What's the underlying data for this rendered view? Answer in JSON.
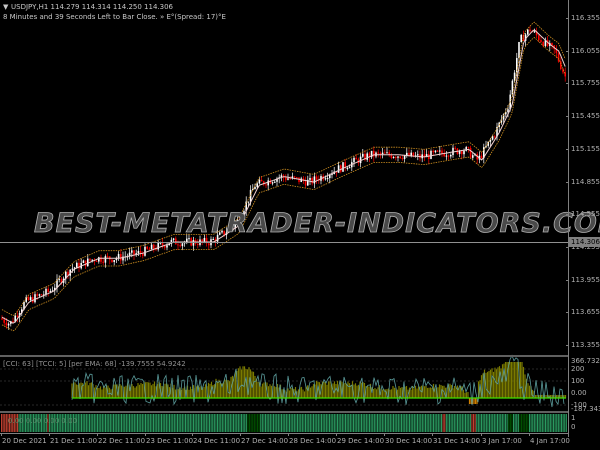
{
  "header": {
    "symbol_line": "USDJPY,H1  114.279 114.314 114.250 114.306",
    "timer_line": "8 Minutes and 39 Seconds Left to Bar Close. » E°(Spread: 17)°E"
  },
  "watermark": "BEST-METATRADER-INDICATORS.COM",
  "price_axis": {
    "labels": [
      "116.355",
      "116.055",
      "115.755",
      "115.455",
      "115.155",
      "114.855",
      "114.555",
      "114.255",
      "113.955",
      "113.655",
      "113.355"
    ],
    "current_price": "114.306"
  },
  "price_path": [
    [
      0,
      113.6
    ],
    [
      10,
      113.55
    ],
    [
      25,
      113.75
    ],
    [
      50,
      113.85
    ],
    [
      70,
      114.05
    ],
    [
      95,
      114.15
    ],
    [
      115,
      114.15
    ],
    [
      140,
      114.2
    ],
    [
      170,
      114.3
    ],
    [
      210,
      114.3
    ],
    [
      235,
      114.45
    ],
    [
      255,
      114.82
    ],
    [
      280,
      114.9
    ],
    [
      310,
      114.85
    ],
    [
      340,
      114.98
    ],
    [
      370,
      115.1
    ],
    [
      395,
      115.1
    ],
    [
      420,
      115.08
    ],
    [
      445,
      115.12
    ],
    [
      465,
      115.15
    ],
    [
      478,
      115.05
    ],
    [
      495,
      115.3
    ],
    [
      508,
      115.55
    ],
    [
      520,
      116.15
    ],
    [
      530,
      116.25
    ],
    [
      545,
      116.12
    ],
    [
      555,
      116.05
    ],
    [
      566,
      115.8
    ]
  ],
  "cci_panel": {
    "label": "[CCI: 63] [TCCI: 5] [per EMA: 68]  -139.7555 54.9242",
    "scale": [
      "366.7323",
      "200",
      "100",
      "0.00",
      "-100",
      "-187.3439"
    ]
  },
  "trend_panel": {
    "label": "0.00  0.00  0.00  0.00",
    "scale": [
      "1",
      "0"
    ]
  },
  "time_axis": [
    "20 Dec 2021",
    "21 Dec 11:00",
    "22 Dec 11:00",
    "23 Dec 11:00",
    "24 Dec 11:00",
    "27 Dec 14:00",
    "28 Dec 14:00",
    "29 Dec 14:00",
    "30 Dec 14:00",
    "31 Dec 14:00",
    "3 Jan 17:00",
    "4 Jan 17:00"
  ],
  "colors": {
    "bull": "#ffffff",
    "bear": "#ff0000",
    "ma": "#f0d0d0",
    "band": "#d09020",
    "cci_fill": "#7a7a00",
    "cci_line": "#5a9a9a",
    "zero": "#40e000",
    "trend_up": "#2a9a60",
    "trend_strong": "#005000",
    "trend_down": "#c04030"
  }
}
